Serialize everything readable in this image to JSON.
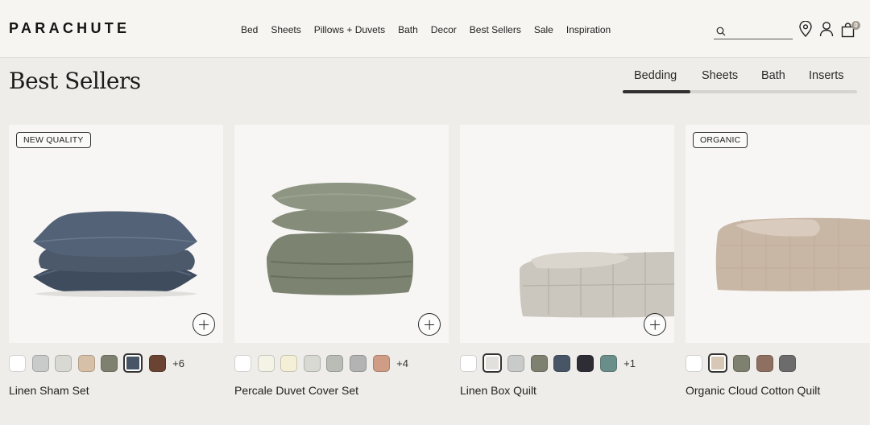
{
  "brand": "PARACHUTE",
  "nav": [
    "Bed",
    "Sheets",
    "Pillows + Duvets",
    "Bath",
    "Decor",
    "Best Sellers",
    "Sale",
    "Inspiration"
  ],
  "search": {
    "placeholder": "",
    "value": ""
  },
  "header_icons": [
    "location-pin-icon",
    "account-icon",
    "shopping-bag-icon"
  ],
  "cart_count": "0",
  "page_title": "Best Sellers",
  "tabs": [
    "Bedding",
    "Sheets",
    "Bath",
    "Inserts"
  ],
  "active_tab": "Bedding",
  "tab_progress": 0.29,
  "products": [
    {
      "name": "Linen Sham Set",
      "badge": "NEW QUALITY",
      "swatches": [
        "#ffffff",
        "#c9cbcb",
        "#d9d9d4",
        "#d6c0a8",
        "#7f8170",
        "#475567",
        "#6a4333"
      ],
      "selected_swatch": 5,
      "more": "+6"
    },
    {
      "name": "Percale Duvet Cover Set",
      "badge": "",
      "swatches": [
        "#ffffff",
        "#f4f3e6",
        "#f4efd7",
        "#d9d9d3",
        "#b9bdb6",
        "#b3b3b3",
        "#cf9c86"
      ],
      "selected_swatch": -1,
      "more": "+4"
    },
    {
      "name": "Linen Box Quilt",
      "badge": "",
      "swatches": [
        "#ffffff",
        "#e2e0dc",
        "#c9cbcb",
        "#7f8170",
        "#475567",
        "#2e2c35",
        "#6a8f8a"
      ],
      "selected_swatch": 1,
      "more": "+1"
    },
    {
      "name": "Organic Cloud Cotton Quilt",
      "badge": "ORGANIC",
      "swatches": [
        "#ffffff",
        "#d6c8b4",
        "#7f8170",
        "#8f6f60",
        "#6c6c6c"
      ],
      "selected_swatch": 1,
      "more": ""
    }
  ]
}
